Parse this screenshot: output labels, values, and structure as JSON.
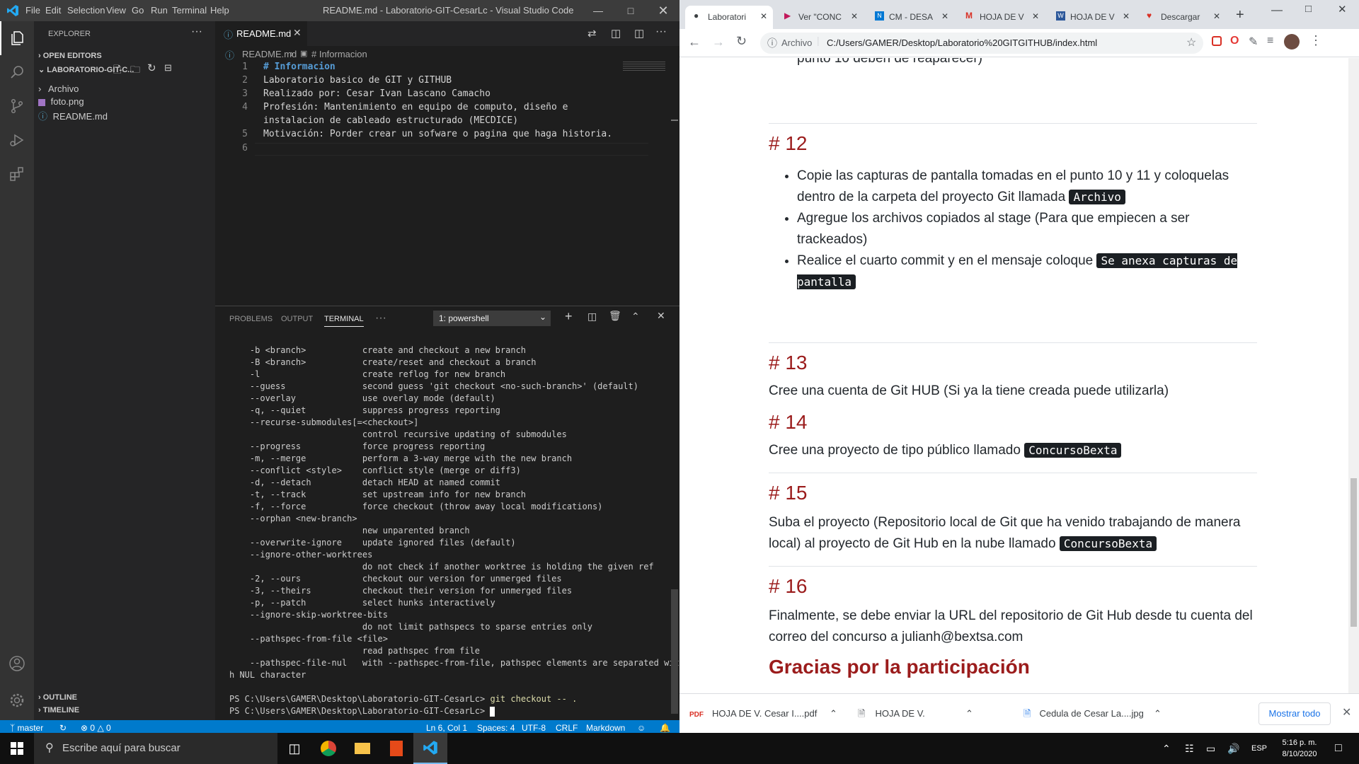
{
  "vscode": {
    "menu": [
      "File",
      "Edit",
      "Selection",
      "View",
      "Go",
      "Run",
      "Terminal",
      "Help"
    ],
    "window_title": "README.md - Laboratorio-GIT-CesarLc - Visual Studio Code",
    "explorer": {
      "title": "EXPLORER",
      "open_editors": "OPEN EDITORS",
      "folder": "LABORATORIO-GIT-C...",
      "items": [
        "Archivo",
        "foto.png",
        "README.md"
      ],
      "outline": "OUTLINE",
      "timeline": "TIMELINE"
    },
    "tab": "README.md",
    "breadcrumb": [
      "README.md",
      "# Informacion"
    ],
    "editor_lines": [
      {
        "n": "1",
        "text": "# Informacion"
      },
      {
        "n": "2",
        "text": "Laboratorio basico de GIT y GITHUB"
      },
      {
        "n": "3",
        "text": "Realizado por: Cesar Ivan Lascano Camacho"
      },
      {
        "n": "4",
        "text": "Profesión: Mantenimiento en equipo de computo, diseño e"
      },
      {
        "n": "",
        "text": "instalacion de cableado estructurado (MECDICE)"
      },
      {
        "n": "5",
        "text": "Motivación: Porder crear un sofware o pagina que haga historia."
      },
      {
        "n": "6",
        "text": ""
      }
    ],
    "panel_tabs": [
      "PROBLEMS",
      "OUTPUT",
      "TERMINAL",
      "···"
    ],
    "terminal_select": "1: powershell",
    "terminal_lines": [
      "    -b <branch>           create and checkout a new branch",
      "    -B <branch>           create/reset and checkout a branch",
      "    -l                    create reflog for new branch",
      "    --guess               second guess 'git checkout <no-such-branch>' (default)",
      "    --overlay             use overlay mode (default)",
      "    -q, --quiet           suppress progress reporting",
      "    --recurse-submodules[=<checkout>]",
      "                          control recursive updating of submodules",
      "    --progress            force progress reporting",
      "    -m, --merge           perform a 3-way merge with the new branch",
      "    --conflict <style>    conflict style (merge or diff3)",
      "    -d, --detach          detach HEAD at named commit",
      "    -t, --track           set upstream info for new branch",
      "    -f, --force           force checkout (throw away local modifications)",
      "    --orphan <new-branch>",
      "                          new unparented branch",
      "    --overwrite-ignore    update ignored files (default)",
      "    --ignore-other-worktrees",
      "                          do not check if another worktree is holding the given ref",
      "    -2, --ours            checkout our version for unmerged files",
      "    -3, --theirs          checkout their version for unmerged files",
      "    -p, --patch           select hunks interactively",
      "    --ignore-skip-worktree-bits",
      "                          do not limit pathspecs to sparse entries only",
      "    --pathspec-from-file <file>",
      "                          read pathspec from file",
      "    --pathspec-file-nul   with --pathspec-from-file, pathspec elements are separated wit",
      "h NUL character",
      ""
    ],
    "prompt1": "PS C:\\Users\\GAMER\\Desktop\\Laboratorio-GIT-CesarLc> ",
    "cmd1": "git checkout -- .",
    "prompt2": "PS C:\\Users\\GAMER\\Desktop\\Laboratorio-GIT-CesarLc> ",
    "status": {
      "branch": "master",
      "errors": "0",
      "warnings": "0",
      "position": "Ln 6, Col 1",
      "spaces": "Spaces: 4",
      "encoding": "UTF-8",
      "eol": "CRLF",
      "language": "Markdown"
    }
  },
  "chrome": {
    "tabs": [
      "Laboratori",
      "Ver \"CONC",
      "CM - DESA",
      "HOJA DE V",
      "HOJA DE V",
      "Descargar"
    ],
    "url_prefix": "Archivo",
    "url": "C:/Users/GAMER/Desktop/Laboratorio%20GITGITHUB/index.html",
    "page": {
      "top_text": "punto 10 deben de reaparecer)",
      "s12_title": "# 12",
      "s12_b1a": "Copie las capturas de pantalla tomadas en el punto 10 y 11 y coloquelas dentro de la carpeta del proyecto Git llamada ",
      "s12_b1code": "Archivo",
      "s12_b2": "Agregue los archivos copiados al stage (Para que empiecen a ser trackeados)",
      "s12_b3a": "Realice el cuarto commit y en el mensaje coloque ",
      "s12_b3code": "Se anexa capturas de pantalla",
      "s13_title": "# 13",
      "s13_text": "Cree una cuenta de Git HUB (Si ya la tiene creada puede utilizarla)",
      "s14_title": "# 14",
      "s14_text": "Cree una proyecto de tipo público llamado ",
      "s14_code": "ConcursoBexta",
      "s15_title": "# 15",
      "s15_text": "Suba el proyecto (Repositorio local de Git que ha venido trabajando de manera local) al proyecto de Git Hub en la nube llamado ",
      "s15_code": "ConcursoBexta",
      "s16_title": "# 16",
      "s16_text": "Finalmente, se debe enviar la URL del repositorio de Git Hub desde tu cuenta del correo del concurso a julianh@bextsa.com",
      "thanks": "Gracias por la participación"
    },
    "downloads": [
      "HOJA DE V. Cesar I....pdf",
      "HOJA DE V.",
      "Cedula de Cesar La....jpg"
    ],
    "show_all": "Mostrar todo"
  },
  "taskbar": {
    "search_placeholder": "Escribe aquí para buscar",
    "lang": "ESP",
    "time": "5:16 p. m.",
    "date": "8/10/2020"
  },
  "colors": {
    "vscode_accent": "#007acc",
    "heading_red": "#9b1c1c",
    "code_bg": "#1b1f23"
  }
}
